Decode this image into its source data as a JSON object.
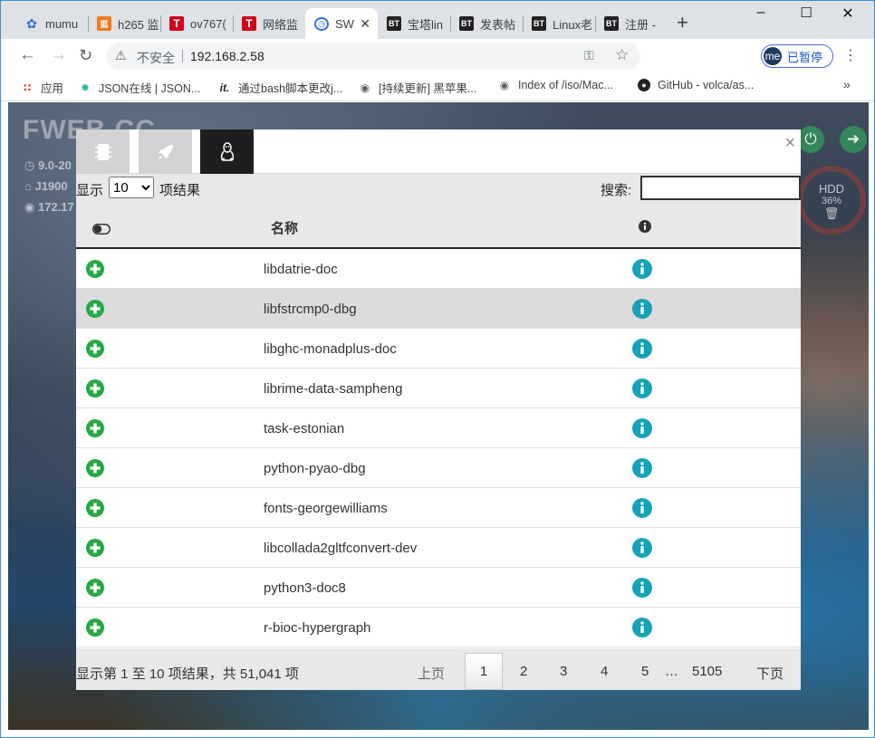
{
  "browser": {
    "tabs": [
      {
        "label": "mumu",
        "icon": "paw-icon"
      },
      {
        "label": "h265 监",
        "icon": "sohu-icon"
      },
      {
        "label": "ov767(",
        "icon": "t-icon"
      },
      {
        "label": "网络监",
        "icon": "t-icon"
      },
      {
        "label": "SW",
        "icon": "sw-icon",
        "active": true
      },
      {
        "label": "宝塔lin",
        "icon": "bt-icon"
      },
      {
        "label": "发表帖",
        "icon": "bt-icon"
      },
      {
        "label": "Linux老",
        "icon": "bt-icon"
      },
      {
        "label": "注册 -",
        "icon": "bt-icon"
      }
    ],
    "new_tab": "+",
    "address": {
      "insecure_label": "不安全",
      "url": "192.168.2.58"
    },
    "profile": {
      "initials": "me",
      "status": "已暂停"
    },
    "bookmarks": [
      {
        "label": "应用",
        "icon": "apps-icon"
      },
      {
        "label": "JSON在线 | JSON...",
        "icon": "json-icon"
      },
      {
        "label": "通过bash脚本更改j...",
        "icon": "it-icon"
      },
      {
        "label": "[持续更新] 黑苹果...",
        "icon": "globe-icon"
      },
      {
        "label": "Index of /iso/Mac...",
        "icon": "globe-icon"
      },
      {
        "label": "GitHub - volca/as...",
        "icon": "github-icon"
      }
    ],
    "more": "»"
  },
  "background_page": {
    "title": "FWEB CC",
    "info_lines": [
      "9.0-20",
      "J1900",
      "172.17"
    ],
    "hdd": {
      "label": "HDD",
      "percent": "36%"
    }
  },
  "modal": {
    "close": "×",
    "tabs": [
      {
        "icon": "chip-icon",
        "active": false
      },
      {
        "icon": "rocket-icon",
        "active": false
      },
      {
        "icon": "linux-tux-icon",
        "active": true
      }
    ],
    "length": {
      "prefix": "显示",
      "value": "10",
      "options": [
        "10"
      ],
      "suffix": "项结果"
    },
    "search": {
      "label": "搜索:",
      "value": ""
    },
    "columns": {
      "name": "名称"
    },
    "rows": [
      {
        "name": "libdatrie-doc"
      },
      {
        "name": "libfstrcmp0-dbg"
      },
      {
        "name": "libghc-monadplus-doc"
      },
      {
        "name": "librime-data-sampheng"
      },
      {
        "name": "task-estonian"
      },
      {
        "name": "python-pyao-dbg"
      },
      {
        "name": "fonts-georgewilliams"
      },
      {
        "name": "libcollada2gltfconvert-dev"
      },
      {
        "name": "python3-doc8"
      },
      {
        "name": "r-bioc-hypergraph"
      }
    ],
    "summary": "显示第 1 至 10 项结果，共 51,041 项",
    "pagination": {
      "prev": "上页",
      "pages": [
        "1",
        "2",
        "3",
        "4",
        "5"
      ],
      "current": "1",
      "ellipsis": "…",
      "last": "5105",
      "next": "下页"
    },
    "colors": {
      "add": "#28a745",
      "info": "#17a2b8",
      "active_tab": "#1e1e1e"
    }
  }
}
